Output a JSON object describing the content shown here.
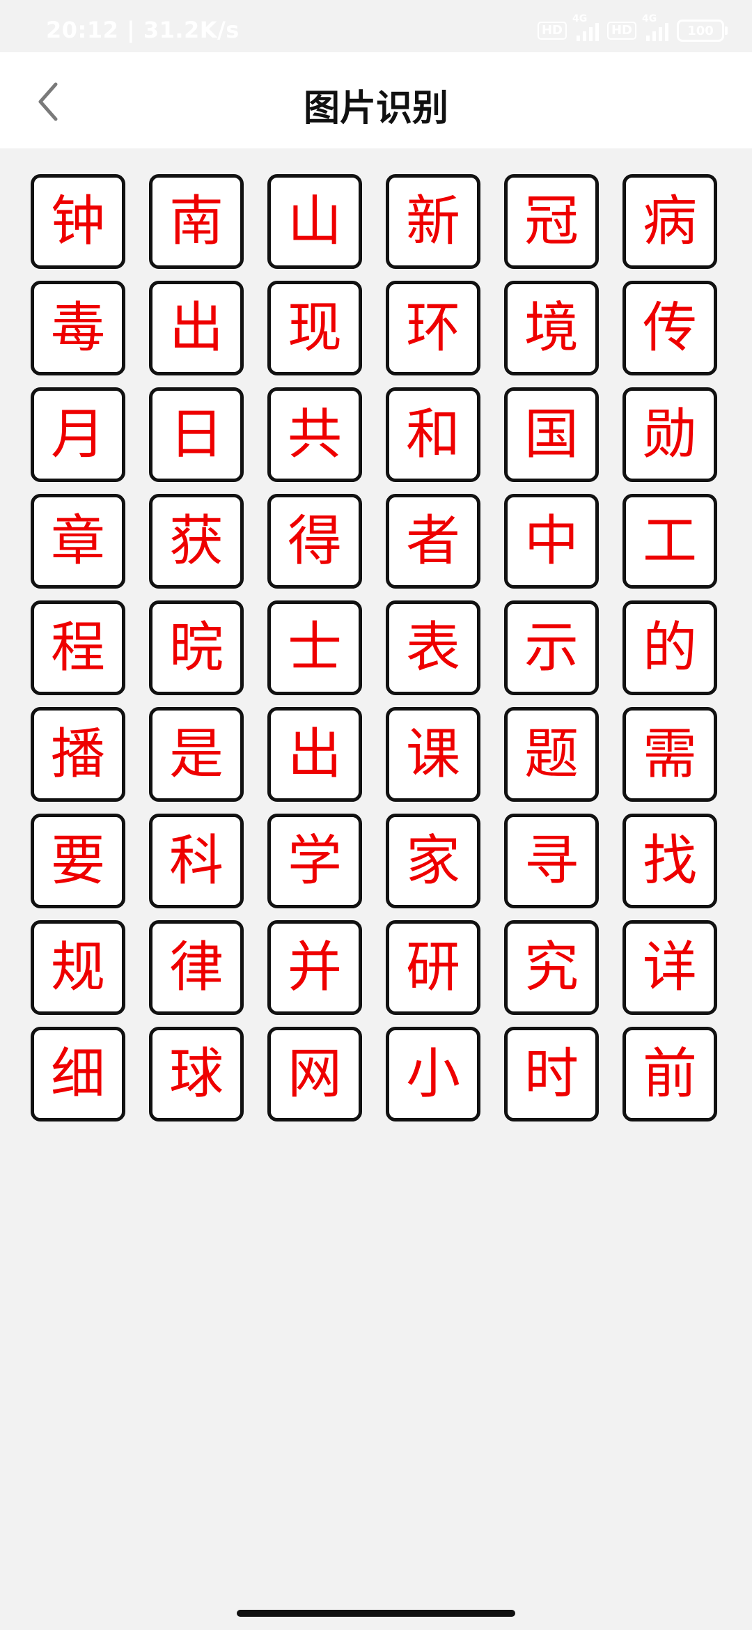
{
  "status_bar": {
    "time": "20:12 | 31.2K/s",
    "hd1": "HD",
    "net1": "4G",
    "hd2": "HD",
    "net2": "4G",
    "battery": "100"
  },
  "header": {
    "back_icon": "chevron-left-icon",
    "title": "图片识别"
  },
  "characters": [
    "钟",
    "南",
    "山",
    "新",
    "冠",
    "病",
    "毒",
    "出",
    "现",
    "环",
    "境",
    "传",
    "月",
    "日",
    "共",
    "和",
    "国",
    "勋",
    "章",
    "获",
    "得",
    "者",
    "中",
    "工",
    "程",
    "晥",
    "士",
    "表",
    "示",
    "的",
    "播",
    "是",
    "出",
    "课",
    "题",
    "需",
    "要",
    "科",
    "学",
    "家",
    "寻",
    "找",
    "规",
    "律",
    "并",
    "研",
    "究",
    "详",
    "细",
    "球",
    "网",
    "小",
    "时",
    "前"
  ],
  "colors": {
    "character_text": "#ee0000",
    "tile_border": "#111111",
    "background": "#f2f2f2"
  }
}
